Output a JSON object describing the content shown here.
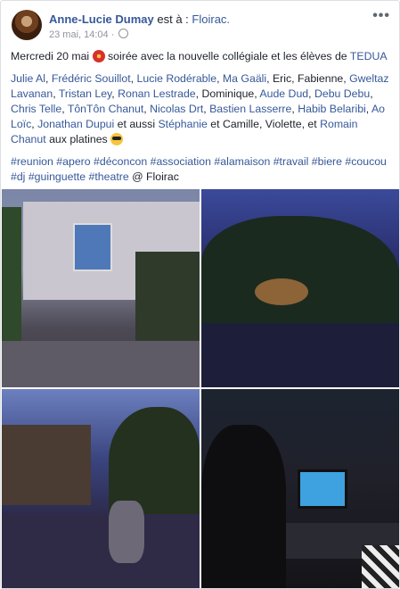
{
  "post": {
    "author": "Anne-Lucie Dumay",
    "est_a": "est à :",
    "location": "Floirac.",
    "timestamp": "23 mai, 14:04",
    "dot": "·",
    "more": "•••",
    "line1_start": "Mercredi 20 mai",
    "line1_mid": "soirée avec la nouvelle collégiale et les élèves de",
    "line1_link": "TEDUA",
    "tags": [
      {
        "name": "Julie Al",
        "link": true,
        "sep": ", "
      },
      {
        "name": "Frédéric Souillot",
        "link": true,
        "sep": ", "
      },
      {
        "name": "Lucie Rodérable",
        "link": true,
        "sep": ", "
      },
      {
        "name": "Ma Gaäli",
        "link": true,
        "sep": ", "
      },
      {
        "name": "Eric, Fabienne, ",
        "link": false,
        "sep": ""
      },
      {
        "name": "Gweltaz Lavanan",
        "link": true,
        "sep": ", "
      },
      {
        "name": "Tristan Ley",
        "link": true,
        "sep": ", "
      },
      {
        "name": "Ronan Lestrade",
        "link": true,
        "sep": ", "
      },
      {
        "name": "Dominique, ",
        "link": false,
        "sep": ""
      },
      {
        "name": "Aude Dud",
        "link": true,
        "sep": ", "
      },
      {
        "name": "Debu Debu",
        "link": true,
        "sep": ", "
      },
      {
        "name": "Chris Telle",
        "link": true,
        "sep": ", "
      },
      {
        "name": "TônTôn Chanut",
        "link": true,
        "sep": ", "
      },
      {
        "name": "Nicolas Drt",
        "link": true,
        "sep": ", "
      },
      {
        "name": "Bastien Lasserre",
        "link": true,
        "sep": ", "
      },
      {
        "name": "Habib Belaribi",
        "link": true,
        "sep": ", "
      },
      {
        "name": "Ao Loïc",
        "link": true,
        "sep": ", "
      },
      {
        "name": "Jonathan Dupui",
        "link": true,
        "sep": " "
      },
      {
        "name": "et aussi ",
        "link": false,
        "sep": ""
      },
      {
        "name": "Stéphanie",
        "link": true,
        "sep": " "
      },
      {
        "name": "et Camille, Violette, et ",
        "link": false,
        "sep": ""
      },
      {
        "name": "Romain Chanut",
        "link": true,
        "sep": " "
      },
      {
        "name": "aux platines",
        "link": false,
        "sep": " "
      }
    ],
    "hashtags": [
      "#reunion",
      "#apero",
      "#déconcon",
      "#association",
      "#alamaison",
      "#travail",
      "#biere",
      "#coucou",
      "#dj",
      "#guinguette",
      "#theatre"
    ],
    "place_suffix": "@ Floirac",
    "photos": [
      "photo-1",
      "photo-2",
      "photo-3",
      "photo-4"
    ]
  }
}
